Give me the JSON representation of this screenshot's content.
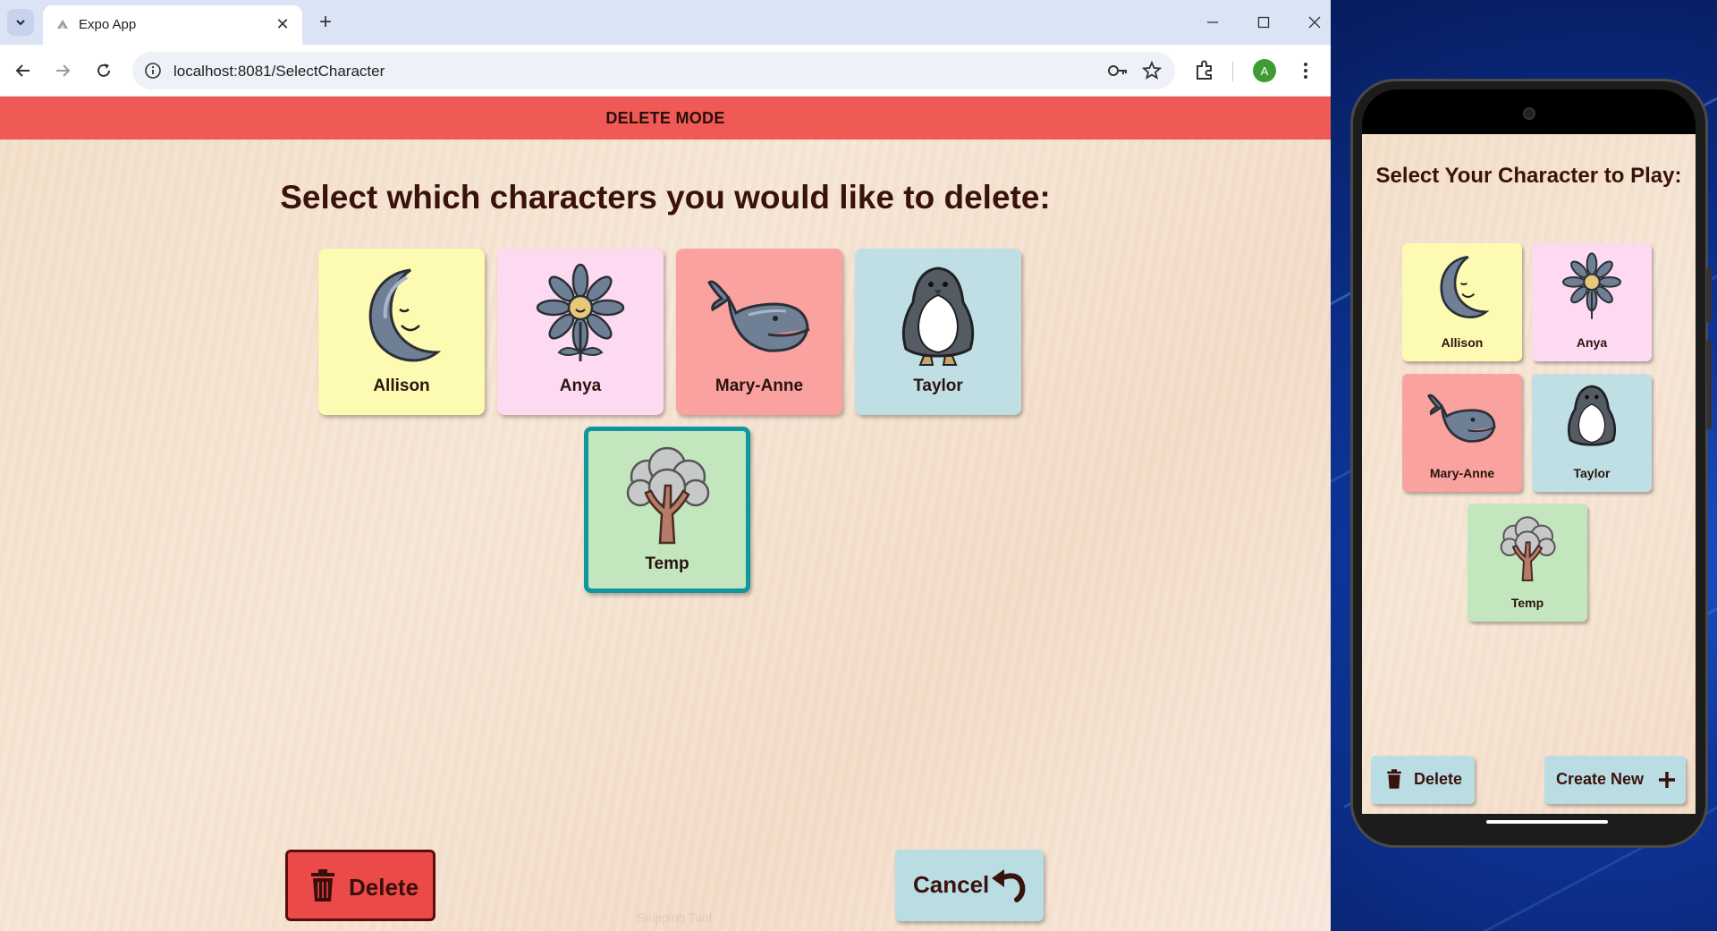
{
  "browser": {
    "tab_title": "Expo App",
    "url": "localhost:8081/SelectCharacter",
    "profile_initial": "A"
  },
  "app": {
    "banner": "DELETE MODE",
    "heading": "Select which characters you would like to delete:",
    "characters": [
      {
        "name": "Allison",
        "icon": "moon-icon",
        "color": "#fdfab2",
        "selected": false
      },
      {
        "name": "Anya",
        "icon": "flower-icon",
        "color": "#fddaf1",
        "selected": false
      },
      {
        "name": "Mary-Anne",
        "icon": "whale-icon",
        "color": "#f9a2a0",
        "selected": false
      },
      {
        "name": "Taylor",
        "icon": "penguin-icon",
        "color": "#bfdfe4",
        "selected": false
      },
      {
        "name": "Temp",
        "icon": "tree-icon",
        "color": "#c3e6bf",
        "selected": true
      }
    ],
    "delete_label": "Delete",
    "cancel_label": "Cancel",
    "watermark": "Snipping Tool"
  },
  "phone": {
    "title": "Select Your Character to Play:",
    "characters": [
      "Allison",
      "Anya",
      "Mary-Anne",
      "Taylor",
      "Temp"
    ],
    "delete_label": "Delete",
    "create_label": "Create New"
  },
  "colors": {
    "banner": "#ef5a56",
    "selection_border": "#0f97a0",
    "delete_button": "#ec4a48",
    "cancel_button": "#b9dde2"
  }
}
